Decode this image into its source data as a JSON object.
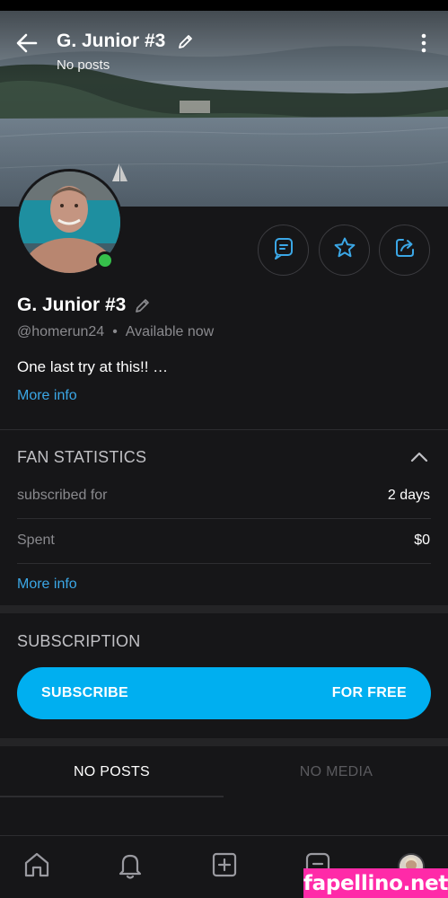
{
  "header": {
    "title": "G. Junior #3",
    "subtitle": "No posts"
  },
  "profile": {
    "name": "G. Junior #3",
    "handle": "@homerun24",
    "separator": "•",
    "status": "Available now",
    "bio": "One last try at this!! …",
    "more_info": "More info",
    "online": true
  },
  "actions": {
    "message_icon": "message-icon",
    "favorite_icon": "star-icon",
    "share_icon": "share-icon"
  },
  "fan_statistics": {
    "title": "FAN STATISTICS",
    "rows": [
      {
        "label": "subscribed for",
        "value": "2 days"
      },
      {
        "label": "Spent",
        "value": "$0"
      }
    ],
    "more_info": "More info"
  },
  "subscription": {
    "title": "SUBSCRIPTION",
    "button_label": "SUBSCRIBE",
    "button_price": "FOR FREE"
  },
  "tabs": [
    {
      "label": "NO POSTS",
      "active": true
    },
    {
      "label": "NO MEDIA",
      "active": false
    }
  ],
  "bottom_nav": [
    "home-icon",
    "bell-icon",
    "add-post-icon",
    "messages-icon",
    "profile-avatar"
  ],
  "watermark": "fapellino.net",
  "colors": {
    "background": "#161618",
    "accent": "#00aff0",
    "link": "#3ba7e6",
    "online": "#36c04b",
    "watermark": "#ff2aa8"
  }
}
